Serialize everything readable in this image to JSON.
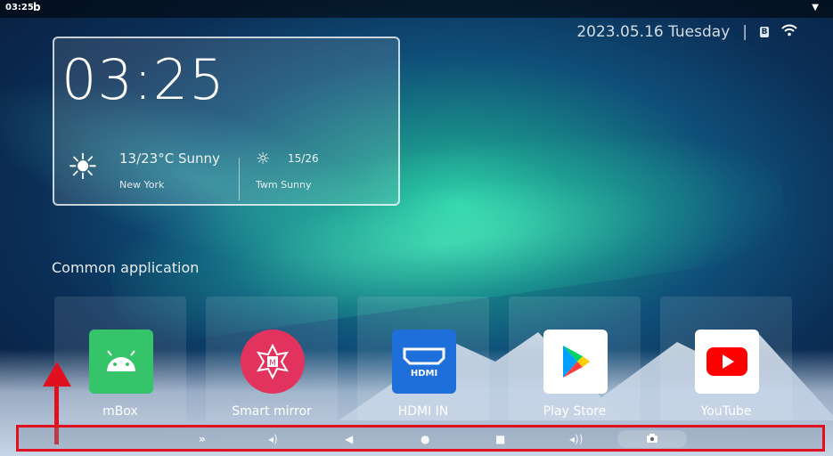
{
  "status_bar": {
    "time": "03:25",
    "app_glyph": "b"
  },
  "top_right": {
    "date": "2023.05.16 Tuesday",
    "separator": "|",
    "bt_glyph": "B"
  },
  "clock_card": {
    "time": "03:25",
    "weather_main": "13/23°C Sunny",
    "city": "New York",
    "weather_secondary": "15/26",
    "secondary_label": "Twm Sunny"
  },
  "section_title": "Common application",
  "apps": [
    {
      "label": "mBox",
      "icon": "android-icon"
    },
    {
      "label": "Smart mirror",
      "icon": "smart-mirror-icon"
    },
    {
      "label": "HDMI IN",
      "icon": "hdmi-icon",
      "badge": "HDMI"
    },
    {
      "label": "Play Store",
      "icon": "play-store-icon"
    },
    {
      "label": "YouTube",
      "icon": "youtube-icon"
    }
  ],
  "nav": {
    "collapse": "»",
    "vol_down": "◂)",
    "back": "◀",
    "home": "●",
    "recents": "■",
    "vol_up": "◂))",
    "screenshot": "📷"
  },
  "colors": {
    "highlight": "#e0101e",
    "accent_teal": "#2fd0a8"
  }
}
